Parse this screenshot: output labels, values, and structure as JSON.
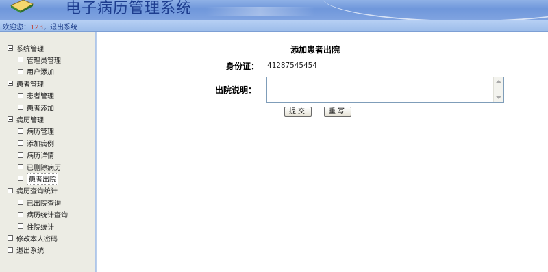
{
  "header": {
    "app_title": "电子病历管理系统"
  },
  "userbar": {
    "welcome_prefix": "欢迎您：",
    "username": "123",
    "separator": "，",
    "logout_link": "退出系统"
  },
  "sidebar": {
    "items": [
      {
        "label": "系统管理",
        "level": 0,
        "expanded": true
      },
      {
        "label": "管理员管理",
        "level": 1
      },
      {
        "label": "用户添加",
        "level": 1
      },
      {
        "label": "患者管理",
        "level": 0,
        "expanded": true
      },
      {
        "label": "患者管理",
        "level": 1
      },
      {
        "label": "患者添加",
        "level": 1
      },
      {
        "label": "病历管理",
        "level": 0,
        "expanded": true
      },
      {
        "label": "病历管理",
        "level": 1
      },
      {
        "label": "添加病例",
        "level": 1
      },
      {
        "label": "病历详情",
        "level": 1
      },
      {
        "label": "已删除病历",
        "level": 1
      },
      {
        "label": "患者出院",
        "level": 1,
        "selected": true
      },
      {
        "label": "病历查询统计",
        "level": 0,
        "expanded": true
      },
      {
        "label": "已出院查询",
        "level": 1
      },
      {
        "label": "病历统计查询",
        "level": 1
      },
      {
        "label": "住院统计",
        "level": 1
      },
      {
        "label": "修改本人密码",
        "level": 0
      },
      {
        "label": "退出系统",
        "level": 0
      }
    ]
  },
  "form": {
    "title": "添加患者出院",
    "id_label": "身份证：",
    "id_value": "41287545454",
    "note_label": "出院说明：",
    "note_value": "",
    "submit_label": "提交",
    "reset_label": "重写"
  },
  "colors": {
    "header": "#7fa3e0",
    "title_text": "#1d3d8f",
    "sidebar_bg": "#ecece4"
  }
}
